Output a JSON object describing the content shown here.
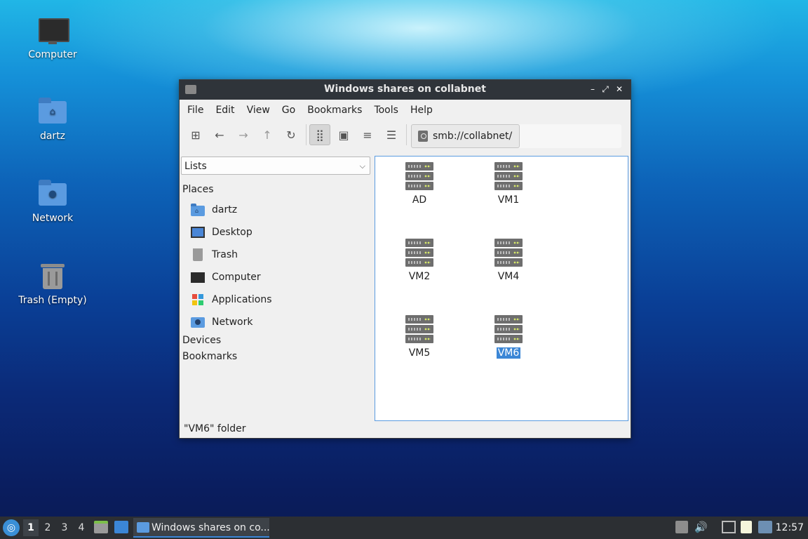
{
  "desktop": {
    "icons": [
      {
        "label": "Computer"
      },
      {
        "label": "dartz"
      },
      {
        "label": "Network"
      },
      {
        "label": "Trash (Empty)"
      }
    ]
  },
  "window": {
    "title": "Windows shares on collabnet",
    "controls": {
      "minimize": "–",
      "maximize": "⤢",
      "close": "✕"
    },
    "menu": [
      "File",
      "Edit",
      "View",
      "Go",
      "Bookmarks",
      "Tools",
      "Help"
    ],
    "toolbar": {
      "new_window": "⊞",
      "back": "←",
      "forward": "→",
      "up": "↑",
      "reload": "↻",
      "icon_view": "⣿",
      "thumb_view": "▣",
      "compact_view": "≡",
      "detail_view": "☰"
    },
    "path": "smb://collabnet/",
    "side": {
      "combo": "Lists",
      "sections": {
        "places": "Places",
        "devices": "Devices",
        "bookmarks": "Bookmarks"
      },
      "places": [
        {
          "label": "dartz"
        },
        {
          "label": "Desktop"
        },
        {
          "label": "Trash"
        },
        {
          "label": "Computer"
        },
        {
          "label": "Applications"
        },
        {
          "label": "Network"
        }
      ]
    },
    "items": [
      "AD",
      "VM1",
      "VM2",
      "VM4",
      "VM5",
      "VM6"
    ],
    "selected": "VM6",
    "status": "\"VM6\" folder"
  },
  "taskbar": {
    "workspaces": [
      "1",
      "2",
      "3",
      "4"
    ],
    "task_label": "Windows shares on co...",
    "clock": "12:57"
  },
  "colors": {
    "accent": "#3b86d6",
    "titlebar": "#2f343a",
    "taskbar": "#2c2f33"
  }
}
